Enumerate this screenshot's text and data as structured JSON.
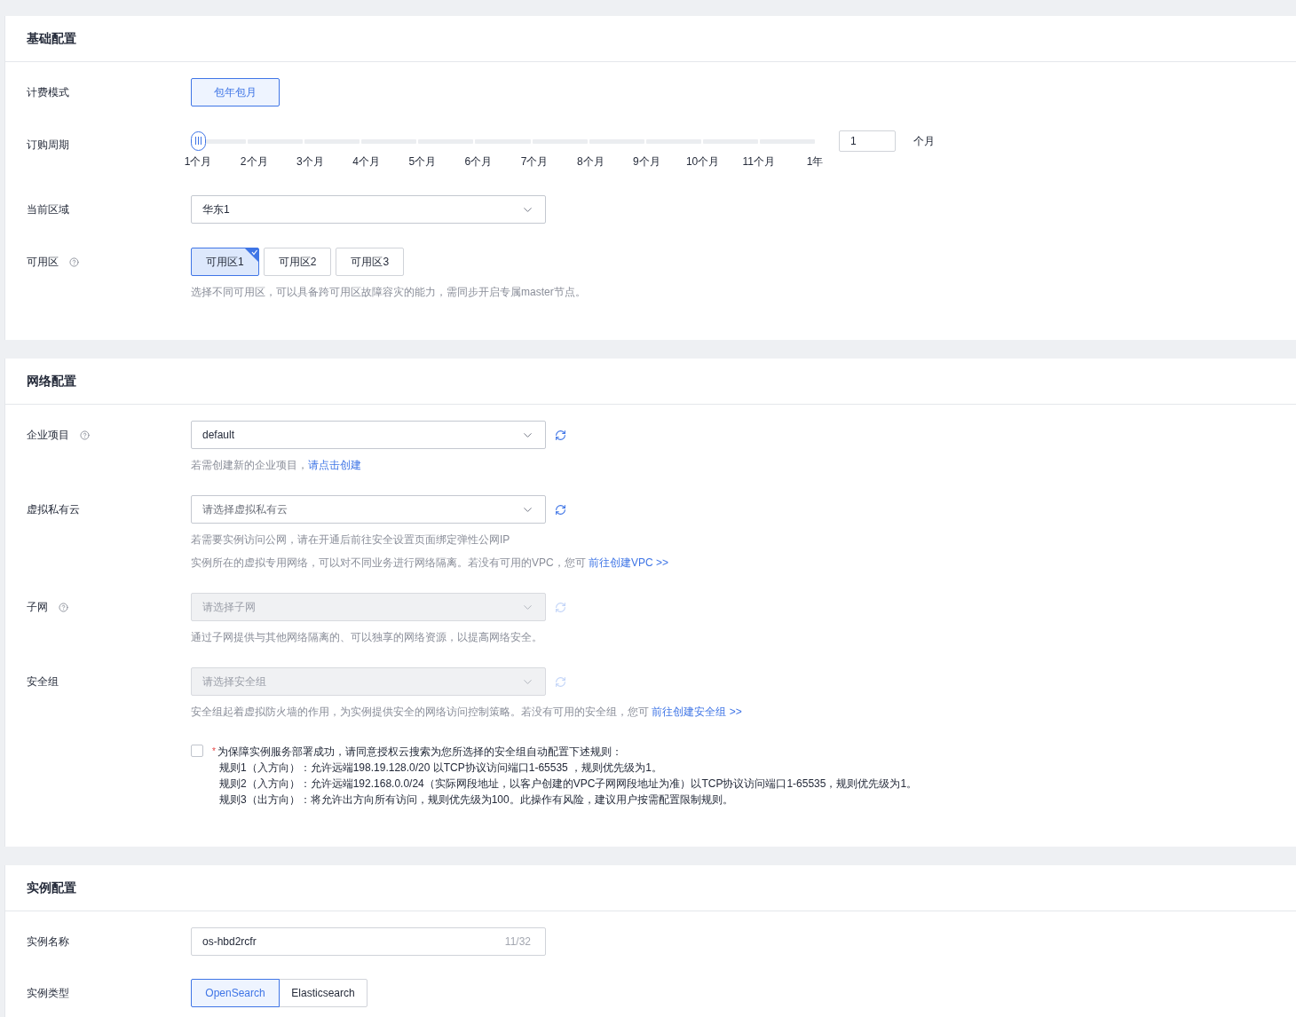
{
  "sections": [
    {
      "title": "基础配置",
      "rows": [
        {
          "kind": "toggle",
          "label": "计费模式",
          "options": [
            {
              "label": "包年包月",
              "selected": true
            }
          ]
        },
        {
          "kind": "slider",
          "label": "订购周期",
          "level": 0,
          "ticks": [
            "1个月",
            "2个月",
            "3个月",
            "4个月",
            "5个月",
            "6个月",
            "7个月",
            "8个月",
            "9个月",
            "10个月",
            "11个月",
            "1年"
          ],
          "value": "1",
          "unit": "个月"
        },
        {
          "kind": "select",
          "label": "当前区域",
          "value": "华东1",
          "disabled": false
        },
        {
          "kind": "zones",
          "label": "可用区",
          "help": true,
          "options": [
            {
              "label": "可用区1",
              "selected": true
            },
            {
              "label": "可用区2",
              "selected": false
            },
            {
              "label": "可用区3",
              "selected": false
            }
          ],
          "notes": [
            {
              "text": "选择不同可用区，可以具备跨可用区故障容灾的能力，需同步开启专属master节点。"
            }
          ]
        }
      ]
    },
    {
      "title": "网络配置",
      "rows": [
        {
          "kind": "select",
          "label": "企业项目",
          "help": true,
          "value": "default",
          "disabled": false,
          "refresh": true,
          "notes": [
            {
              "text": "若需创建新的企业项目，",
              "link": "请点击创建"
            }
          ]
        },
        {
          "kind": "select",
          "label": "虚拟私有云",
          "placeholder": "请选择虚拟私有云",
          "disabled": false,
          "refresh": true,
          "notes": [
            {
              "text": "若需要实例访问公网，请在开通后前往安全设置页面绑定弹性公网IP"
            },
            {
              "text": "实例所在的虚拟专用网络，可以对不同业务进行网络隔离。若没有可用的VPC，您可 ",
              "link": "前往创建VPC >>"
            }
          ]
        },
        {
          "kind": "select",
          "label": "子网",
          "help": true,
          "placeholder": "请选择子网",
          "disabled": true,
          "refresh": true,
          "notes": [
            {
              "text": "通过子网提供与其他网络隔离的、可以独享的网络资源，以提高网络安全。"
            }
          ]
        },
        {
          "kind": "select",
          "label": "安全组",
          "placeholder": "请选择安全组",
          "disabled": true,
          "refresh": true,
          "notes": [
            {
              "text": "安全组起着虚拟防火墙的作用，为实例提供安全的网络访问控制策略。若没有可用的安全组，您可 ",
              "link": "前往创建安全组 >>"
            }
          ]
        },
        {
          "kind": "agreement",
          "checked": false,
          "required": "*",
          "lines": [
            "为保障实例服务部署成功，请同意授权云搜索为您所选择的安全组自动配置下述规则：",
            "规则1（入方向）：允许远端198.19.128.0/20 以TCP协议访问端口1-65535 ，规则优先级为1。",
            "规则2（入方向）：允许远端192.168.0.0/24（实际网段地址，以客户创建的VPC子网网段地址为准）以TCP协议访问端口1-65535，规则优先级为1。",
            "规则3（出方向）：将允许出方向所有访问，规则优先级为100。此操作有风险，建议用户按需配置限制规则。"
          ]
        }
      ]
    },
    {
      "title": "实例配置",
      "rows": [
        {
          "kind": "input",
          "label": "实例名称",
          "value": "os-hbd2rcfr",
          "counter": "11/32"
        },
        {
          "kind": "segmented",
          "label": "实例类型",
          "options": [
            {
              "label": "OpenSearch",
              "selected": true
            },
            {
              "label": "Elasticsearch",
              "selected": false
            }
          ]
        }
      ]
    }
  ]
}
